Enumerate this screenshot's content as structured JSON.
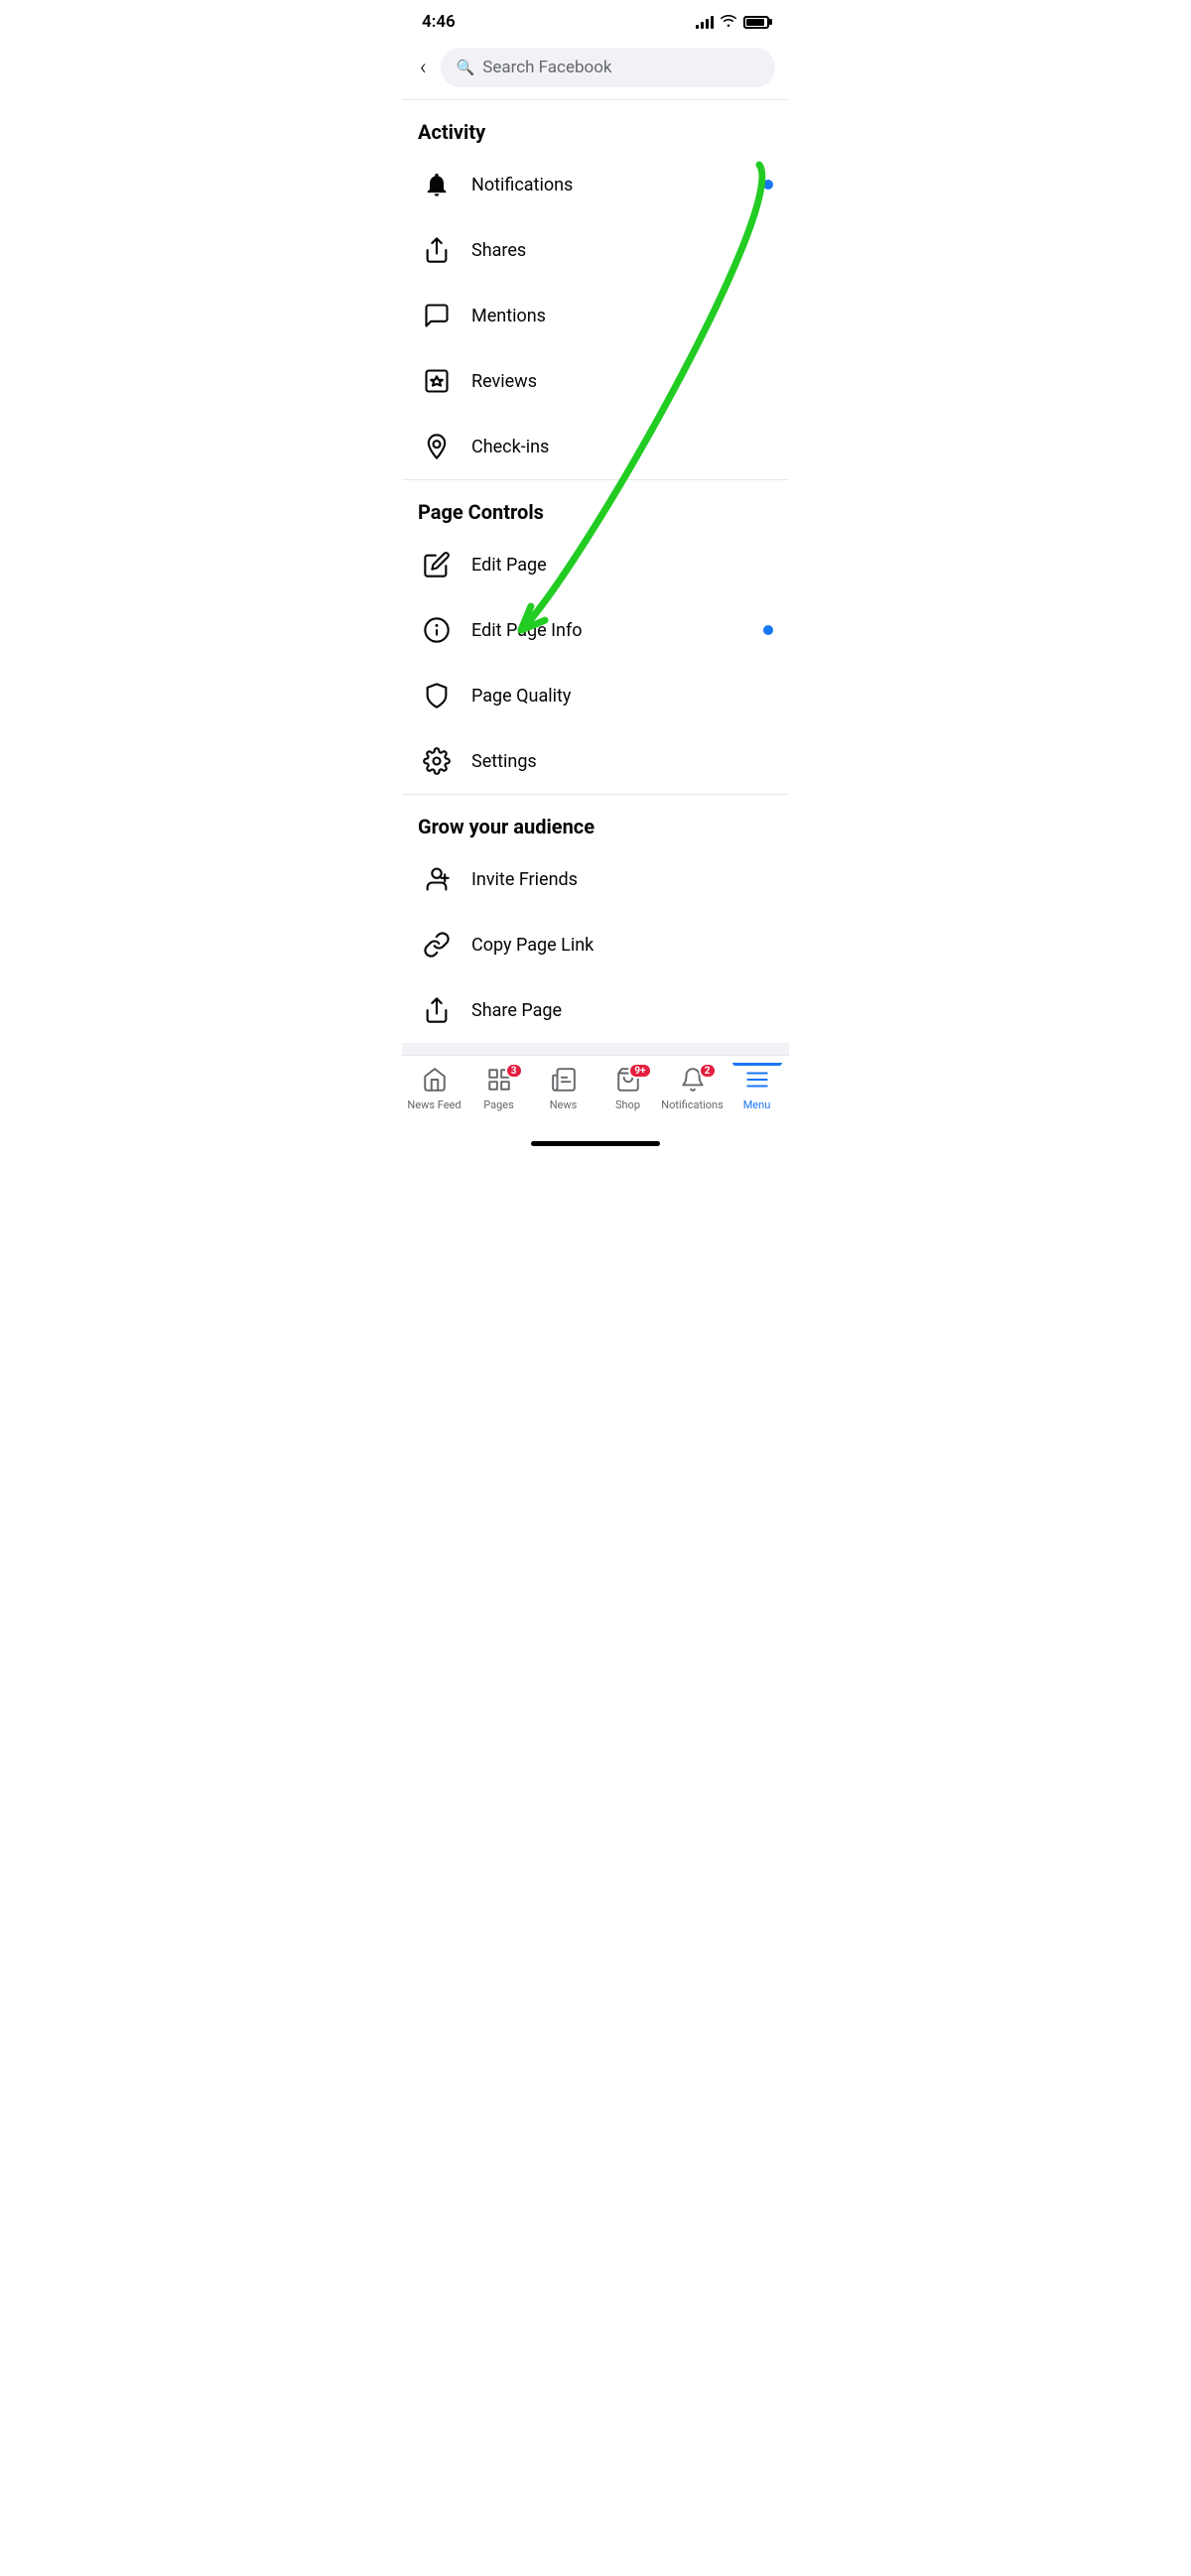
{
  "statusBar": {
    "time": "4:46",
    "battery": 90
  },
  "searchBar": {
    "placeholder": "Search Facebook",
    "backLabel": "‹"
  },
  "sections": [
    {
      "id": "activity",
      "title": "Activity",
      "items": [
        {
          "id": "notifications",
          "label": "Notifications",
          "icon": "bell",
          "hasDot": true
        },
        {
          "id": "shares",
          "label": "Shares",
          "icon": "share",
          "hasDot": false
        },
        {
          "id": "mentions",
          "label": "Mentions",
          "icon": "mention",
          "hasDot": false
        },
        {
          "id": "reviews",
          "label": "Reviews",
          "icon": "reviews",
          "hasDot": false
        },
        {
          "id": "checkins",
          "label": "Check-ins",
          "icon": "checkin",
          "hasDot": false
        }
      ]
    },
    {
      "id": "page-controls",
      "title": "Page Controls",
      "items": [
        {
          "id": "edit-page",
          "label": "Edit Page",
          "icon": "edit",
          "hasDot": false
        },
        {
          "id": "edit-page-info",
          "label": "Edit Page Info",
          "icon": "info",
          "hasDot": true
        },
        {
          "id": "page-quality",
          "label": "Page Quality",
          "icon": "shield",
          "hasDot": false
        },
        {
          "id": "settings",
          "label": "Settings",
          "icon": "settings",
          "hasDot": false
        }
      ]
    },
    {
      "id": "grow-audience",
      "title": "Grow your audience",
      "items": [
        {
          "id": "invite-friends",
          "label": "Invite Friends",
          "icon": "invite",
          "hasDot": false
        },
        {
          "id": "copy-page-link",
          "label": "Copy Page Link",
          "icon": "link",
          "hasDot": false
        },
        {
          "id": "share-page",
          "label": "Share Page",
          "icon": "share",
          "hasDot": false
        }
      ]
    }
  ],
  "tabBar": {
    "items": [
      {
        "id": "news-feed",
        "label": "News Feed",
        "icon": "home",
        "badge": null,
        "active": false
      },
      {
        "id": "pages",
        "label": "Pages",
        "icon": "pages",
        "badge": "3",
        "active": false
      },
      {
        "id": "news",
        "label": "News",
        "icon": "news",
        "badge": null,
        "active": false
      },
      {
        "id": "shop",
        "label": "Shop",
        "icon": "shop",
        "badge": "9+",
        "active": false
      },
      {
        "id": "notifications-tab",
        "label": "Notifications",
        "icon": "bell-tab",
        "badge": "2",
        "active": false
      },
      {
        "id": "menu",
        "label": "Menu",
        "icon": "menu",
        "badge": null,
        "active": true
      }
    ]
  },
  "arrow": {
    "color": "#22cc22"
  }
}
